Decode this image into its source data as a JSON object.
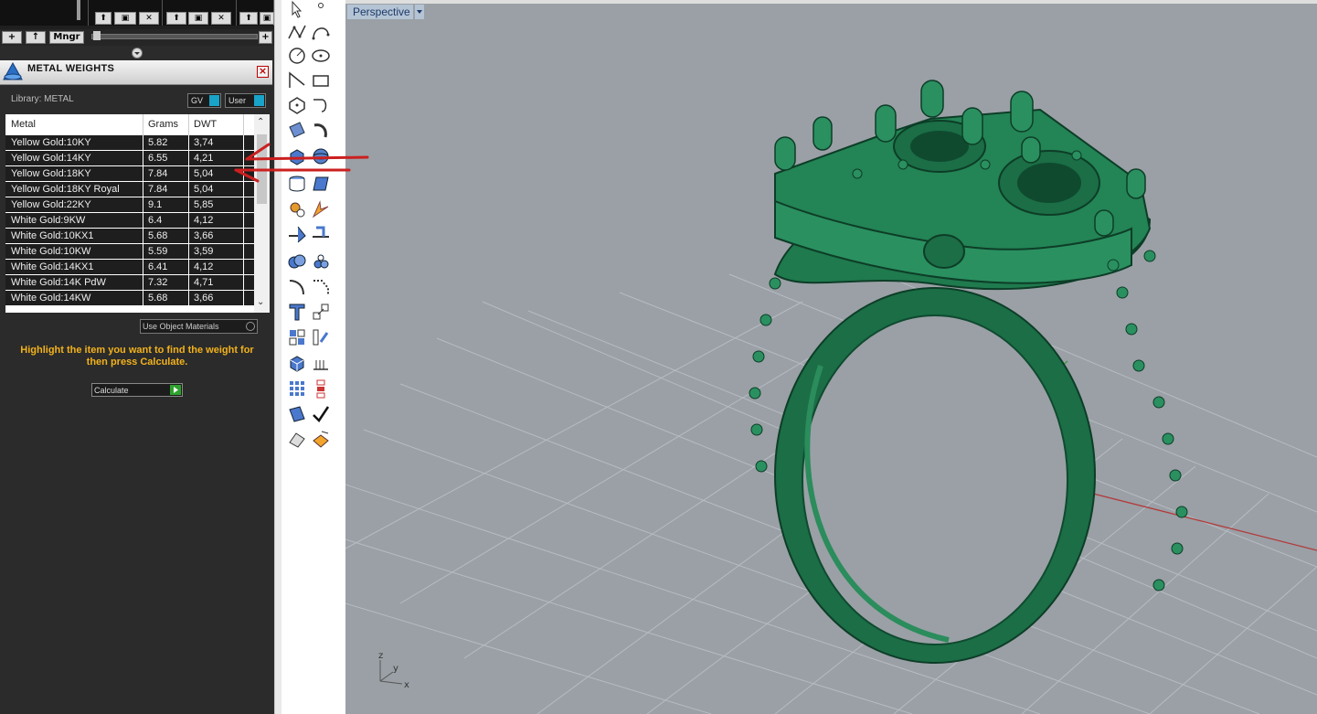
{
  "toolbar_top": {
    "add_label": "+",
    "up_label": "↑",
    "manager_label": "Mngr",
    "plus_label": "+"
  },
  "panel": {
    "title": "METAL WEIGHTS",
    "close_label": "×",
    "library_label": "Library: METAL",
    "gv_label": "GV",
    "user_label": "User"
  },
  "table": {
    "headers": [
      "Metal",
      "Grams",
      "DWT"
    ],
    "rows": [
      [
        "Yellow Gold:10KY",
        "5.82",
        "3,74"
      ],
      [
        "Yellow Gold:14KY",
        "6.55",
        "4,21"
      ],
      [
        "Yellow Gold:18KY",
        "7.84",
        "5,04"
      ],
      [
        "Yellow Gold:18KY Royal",
        "7.84",
        "5,04"
      ],
      [
        "Yellow Gold:22KY",
        "9.1",
        "5,85"
      ],
      [
        "White Gold:9KW",
        "6.4",
        "4,12"
      ],
      [
        "White Gold:10KX1",
        "5.68",
        "3,66"
      ],
      [
        "White Gold:10KW",
        "5.59",
        "3,59"
      ],
      [
        "White Gold:14KX1",
        "6.41",
        "4,12"
      ],
      [
        "White Gold:14K PdW",
        "7.32",
        "4,71"
      ],
      [
        "White Gold:14KW",
        "5.68",
        "3,66"
      ]
    ]
  },
  "use_materials_label": "Use Object Materials",
  "hint_text": "Highlight the item you want to find the weight for then press Calculate.",
  "calculate_label": "Calculate",
  "viewport": {
    "tab_label": "Perspective",
    "axis_labels": {
      "z": "z",
      "y": "y",
      "x": "x"
    },
    "background_color": "#9aa0a6",
    "model_color": "#1e7a4e",
    "grid_color": "#b7bcc2"
  },
  "annotation_color": "#cc1f1f",
  "icons": [
    "select-arrow-icon",
    "point-icon",
    "polyline-icon",
    "curve-icon",
    "circle-icon",
    "ellipse-icon",
    "arc-icon",
    "rectangle-icon",
    "polygon-icon",
    "freeform-curve-icon",
    "surface-icon",
    "sweep-icon",
    "box-solid-icon",
    "sphere-icon",
    "cylinder-icon",
    "plane-surface-icon",
    "gear-explode-icon",
    "burst-icon",
    "split-icon",
    "trim-icon",
    "boolean-icon",
    "array-icon",
    "fillet-icon",
    "chamfer-icon",
    "text-icon",
    "scale-icon",
    "group-icon",
    "align-icon",
    "mesh-icon",
    "dimension-icon",
    "grid-array-icon",
    "gumball-icon",
    "render-icon",
    "check-icon",
    "material-icon",
    "analyze-icon"
  ]
}
